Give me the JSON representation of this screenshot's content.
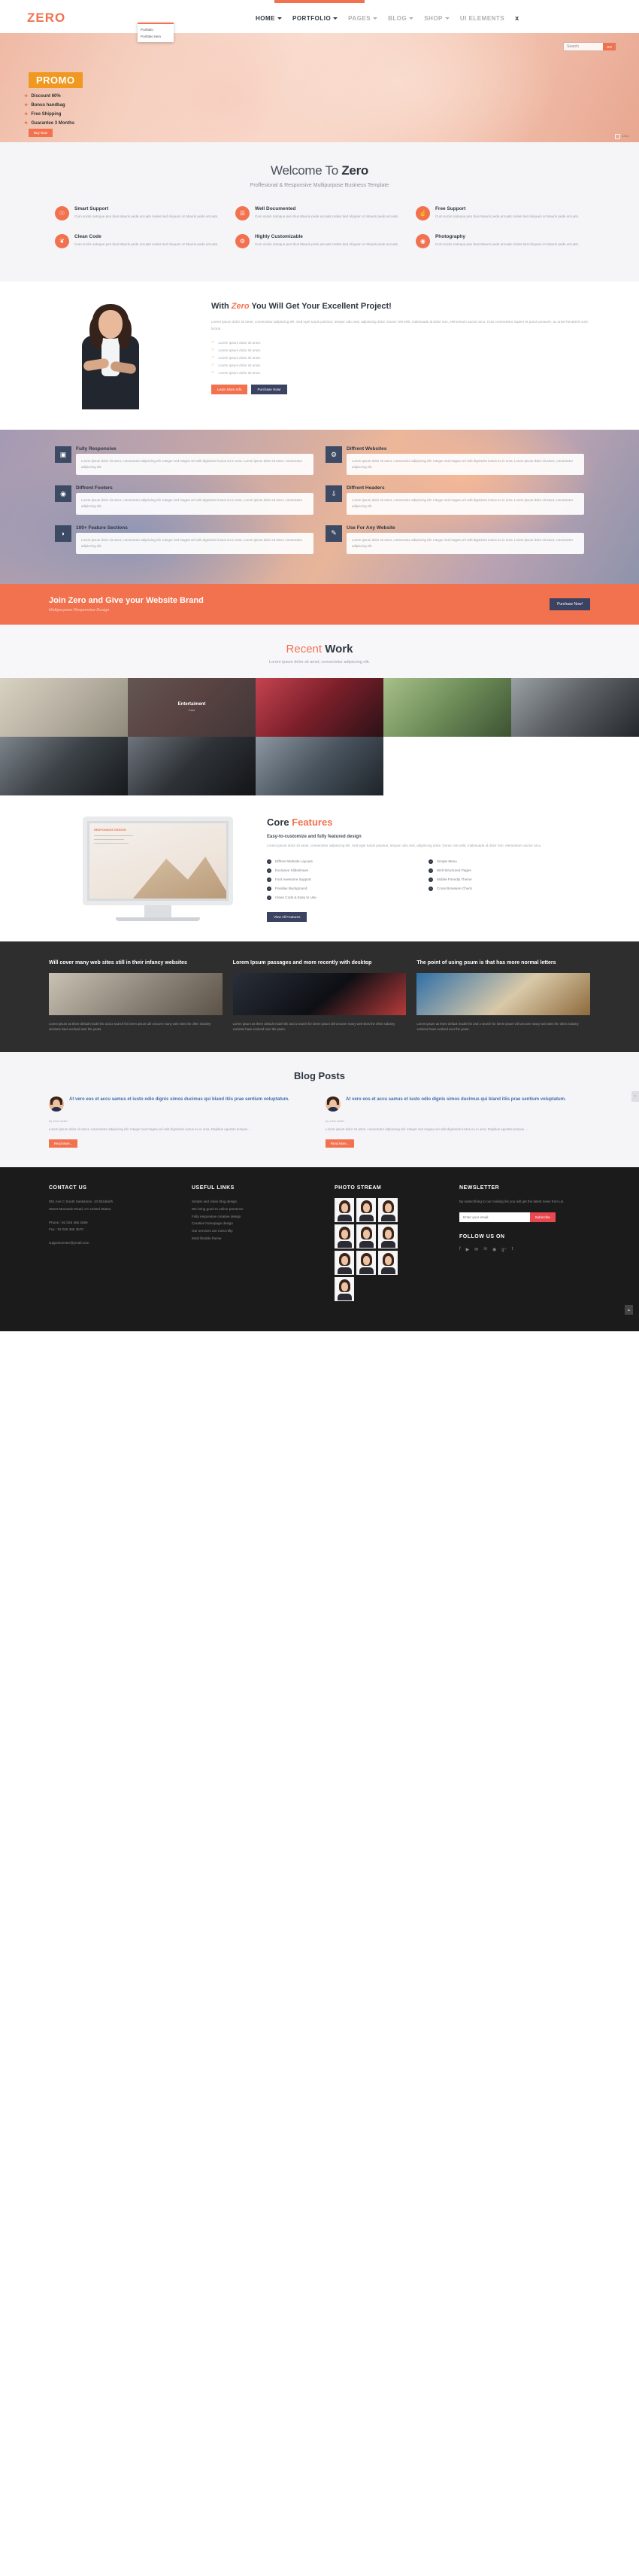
{
  "brand": {
    "logo": "ZERO",
    "accent": "#f2724f",
    "dark": "#3b4262"
  },
  "nav": {
    "items": [
      {
        "label": "HOME",
        "caret": true,
        "active": true
      },
      {
        "label": "PORTFOLIO",
        "caret": true,
        "active": true
      },
      {
        "label": "PAGES",
        "caret": true,
        "active": false
      },
      {
        "label": "BLOG",
        "caret": true,
        "active": false
      },
      {
        "label": "SHOP",
        "caret": true,
        "active": false
      },
      {
        "label": "UI ELEMENTS",
        "caret": false,
        "active": false
      }
    ],
    "close_icon": "x",
    "dropdown": {
      "items": [
        "Portfolio",
        "Portfolio Item"
      ]
    }
  },
  "hero": {
    "search": {
      "placeholder": "Search",
      "value": "Search",
      "button": "GO"
    },
    "promo": "PROMO",
    "bullets": [
      "Discount 60%",
      "Bonus handbag",
      "Free Shipping",
      "Guarantee 3 Months"
    ],
    "buy_label": "Buy Now",
    "slider_index": "1234"
  },
  "welcome": {
    "title_plain": "Welcome To ",
    "title_bold": "Zero",
    "subtitle": "Proffesional & Responsive Multipurpose Business Template",
    "features": [
      {
        "icon": "lightbulb-icon",
        "glyph": "☉",
        "title": "Smart Support",
        "text": "Cum sociis natoque pen ibus Mauris pede arcuats moles tied Aliquam or Mauris pede arcuats."
      },
      {
        "icon": "document-icon",
        "glyph": "☰",
        "title": "Well Documented",
        "text": "Cum sociis natoque pen ibus Mauris pede arcuats moles tied Aliquam or Mauris pede arcuats."
      },
      {
        "icon": "thumbs-up-icon",
        "glyph": "☝",
        "title": "Free Support",
        "text": "Cum sociis natoque pen ibus Mauris pede arcuats moles tied Aliquam or Mauris pede arcuats."
      },
      {
        "icon": "leaf-icon",
        "glyph": "❦",
        "title": "Clean Code",
        "text": "Cum sociis natoque pen ibus Mauris pede arcuats moles tied Aliquam or Mauris pede arcuats."
      },
      {
        "icon": "gears-icon",
        "glyph": "⚙",
        "title": "Highly Customizable",
        "text": "Cum sociis natoque pen ibus Mauris pede arcuats moles tied Aliquam or Mauris pede arcuats."
      },
      {
        "icon": "camera-icon",
        "glyph": "◉",
        "title": "Photography",
        "text": "Cum sociis natoque pen ibus Mauris pede arcuats moles tied Aliquam or Mauris pede arcuats."
      }
    ]
  },
  "project": {
    "title_a": "With ",
    "title_i": "Zero",
    "title_b": " You Will Get Your Excellent Project!",
    "lead": "Lorem ipsum dolor sit amet, consectetur adipiscing elit. Sed eget turpis pulvinar, tempor odio sed, adipiscing dolor. Donec nisi velit, malesuada id dolor non, elementum auctor arcu. Cras consectetur sapien et purus posuere, ac amet hendrerit nunc luctus.",
    "list": [
      "Lorem ipsum dolor sit amet.",
      "Lorem ipsum dolor sit amet.",
      "Lorem ipsum dolor sit amet.",
      "Lorem ipsum dolor sit amet.",
      "Lorem ipsum dolor sit amet."
    ],
    "btn_primary": "Learn More Info",
    "btn_secondary": "Purchase Now!"
  },
  "parallax": {
    "boxes": [
      {
        "icon": "monitor-icon",
        "glyph": "▣",
        "title": "Fully Responsive",
        "text": "Lorem ipsum dolor sit amet, consectetur adipiscing elit. Integer sed magna vel velit dignissim luctus eu in urna. Lorem ipsum dolor sit amet, consectetur adipiscing elit."
      },
      {
        "icon": "gears-icon",
        "glyph": "⚙",
        "title": "Diffrent Websites",
        "text": "Lorem ipsum dolor sit amet, consectetur adipiscing elit. Integer sed magna vel velit dignissim luctus eu in urna. Lorem ipsum dolor sit amet, consectetur adipiscing elit."
      },
      {
        "icon": "camera-icon",
        "glyph": "◉",
        "title": "Diffrent Footers",
        "text": "Lorem ipsum dolor sit amet, consectetur adipiscing elit. Integer sed magna vel velit dignissim luctus eu in urna. Lorem ipsum dolor sit amet, consectetur adipiscing elit."
      },
      {
        "icon": "download-icon",
        "glyph": "⇩",
        "title": "Diffrent Headers",
        "text": "Lorem ipsum dolor sit amet, consectetur adipiscing elit. Integer sed magna vel velit dignissim luctus eu in urna. Lorem ipsum dolor sit amet, consectetur adipiscing elit."
      },
      {
        "icon": "chat-icon",
        "glyph": "◗",
        "title": "100+ Feature Sections",
        "text": "Lorem ipsum dolor sit amet, consectetur adipiscing elit. Integer sed magna vel velit dignissim luctus eu in urna. Lorem ipsum dolor sit amet, consectetur adipiscing elit."
      },
      {
        "icon": "pencil-icon",
        "glyph": "✎",
        "title": "Use For Any Website",
        "text": "Lorem ipsum dolor sit amet, consectetur adipiscing elit. Integer sed magna vel velit dignissim luctus eu in urna. Lorem ipsum dolor sit amet, consectetur adipiscing elit."
      }
    ]
  },
  "cta": {
    "title": "Join Zero and Give your Website Brand",
    "subtitle": "Multipurpose Responsive Design",
    "button": "Purchase Now!"
  },
  "recent_work": {
    "title_a": "Recent ",
    "title_b": "Work",
    "subtitle": "Lorem ipsum dolor sit amet, consectetur adipiscing elit.",
    "overlay": {
      "title": "Entertaiment",
      "category": "Cars"
    },
    "tiles": [
      {
        "name": "blossom-tree",
        "c1": "#b9b2a4",
        "c2": "#d8d2c2",
        "c3": "#8e8a7a"
      },
      {
        "name": "pink-flowers",
        "c1": "#c98f8a",
        "c2": "#e6c1b5",
        "c3": "#8d6f6c"
      },
      {
        "name": "cocktail-glasses",
        "c1": "#7c1f2a",
        "c2": "#c4444f",
        "c3": "#2a1216"
      },
      {
        "name": "green-leaves",
        "c1": "#6f8f5a",
        "c2": "#a9c08a",
        "c3": "#3d5232"
      },
      {
        "name": "sports-car-wheel",
        "c1": "#5b5f63",
        "c2": "#9ba1a6",
        "c3": "#24282c"
      },
      {
        "name": "car-engine",
        "c1": "#3c4247",
        "c2": "#7d848b",
        "c3": "#16191c"
      },
      {
        "name": "car-interior",
        "c1": "#2f3338",
        "c2": "#6d747b",
        "c3": "#121417"
      },
      {
        "name": "action-camera",
        "c1": "#4a5560",
        "c2": "#8d97a1",
        "c3": "#1d2328"
      }
    ]
  },
  "core": {
    "title_a": "Core ",
    "title_b": "Features",
    "subtitle": "Easy-to-customize and fully featured design",
    "text": "Lorem ipsum dolor sit amet, consectetur adipiscing elit. Sed eget turpis pulvinar, tempor odio sed, adipiscing dolor. Donec nisi velit, malesuada id dolor non, elementum auctor arcu.",
    "screen_title": "RESPONSIVE DESIGN",
    "list_left": [
      "Diffrent Website Layouts",
      "Exclusive Slideshows",
      "Font Awesome Support",
      "Parallax Background",
      "Clean Code & Easy to Use"
    ],
    "list_right": [
      "Simple Menu",
      "Well Structured Pages",
      "Mobile Friendly Theme",
      "Cross Browsere Check"
    ],
    "button": "View All Features"
  },
  "news": {
    "items": [
      {
        "title": "Will cover many web sites still in their infancy websites",
        "image": "desk-notebook-photo",
        "text": "Lorem ipsum as there default model the and a search for lorem ipsum will uncover many web sites the often industry versions have evolved over the years."
      },
      {
        "title": "Lorem Ipsum passages and more recently with desktop",
        "image": "smartphone-on-table-photo",
        "text": "Lorem ipsum as there default model the and a search for lorem ipsum will uncover many web sites the often industry versions have evolved over the years."
      },
      {
        "title": "The point of using psum is that has more normal letters",
        "image": "cereal-bowl-photo",
        "text": "Lorem ipsum as there default model the and a search for lorem ipsum will uncover many web sites the often industry versions have evolved over the years."
      }
    ]
  },
  "blog": {
    "title": "Blog Posts",
    "arrow": "›",
    "posts": [
      {
        "headline": "At vero eos et accu samus et iusto odio dignis simos ducimus qui bland itiis prae sentium voluptatum.",
        "meta": "by John smith",
        "text": "Lorem ipsum dolor sit amet, consectetur adipiscing elit. Integer sed magna vel velit dignissim luctus eu in urna. Dapibus egestas tempus ...",
        "button": "Read More..."
      },
      {
        "headline": "At vero eos et accu samus et iusto odio dignis simos ducimus qui bland itiis prae sentium voluptatum.",
        "meta": "by John smith",
        "text": "Lorem ipsum dolor sit amet, consectetur adipiscing elit. Integer sed magna vel velit dignissim luctus eu in urna. Dapibus egestas tempus ...",
        "button": "Read More..."
      }
    ]
  },
  "footer": {
    "contact": {
      "heading": "CONTACT US",
      "address": [
        "051 Ave C South Saskatoon, 10 Elizabeth",
        "Street Mountain Road, CA United States."
      ],
      "phone": "Phone : 92 026 365 2569",
      "fax": "Fax : 92 026 365 2570",
      "email": "supportcenter@ymail.com"
    },
    "links": {
      "heading": "USEFUL LINKS",
      "items": [
        "Simple and clean blog design",
        "We bring good to online presence",
        "Fully responsive creative design",
        "Creative homepage design",
        "Our services are most nifty",
        "Most flexible theme"
      ]
    },
    "photo_stream": {
      "heading": "PHOTO STREAM",
      "count": 10
    },
    "newsletter": {
      "heading": "NEWSLETTER",
      "text": "By subscribing to our mailing list you will get the latest news from us.",
      "placeholder": "Enter your email",
      "button": "Subscribe"
    },
    "follow": {
      "heading": "FOLLOW US ON",
      "icons": [
        "facebook-icon",
        "youtube-icon",
        "envelope-icon",
        "linkedin-icon",
        "dribbble-icon",
        "google-plus-icon",
        "tumblr-icon"
      ],
      "glyphs": [
        "f",
        "▶",
        "✉",
        "in",
        "◉",
        "g⁺",
        "t"
      ]
    },
    "back_to_top": "▲"
  }
}
